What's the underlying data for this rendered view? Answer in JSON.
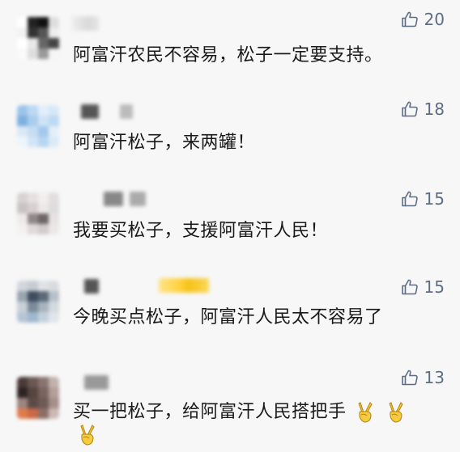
{
  "colors": {
    "background": "#f7f7f7",
    "text": "#1a1a1a",
    "like": "#5e6c85"
  },
  "comments": [
    {
      "text": "阿富汗农民不容易，松子一定要支持。",
      "likes": "20"
    },
    {
      "text": "阿富汗松子，来两罐！",
      "likes": "18"
    },
    {
      "text": "我要买松子，支援阿富汗人民！",
      "likes": "15"
    },
    {
      "text": "今晚买点松子，阿富汗人民太不容易了",
      "likes": "15"
    },
    {
      "text": "买一把松子，给阿富汗人民搭把手",
      "likes": "13",
      "emoji": "victory-hand-emoji"
    }
  ]
}
